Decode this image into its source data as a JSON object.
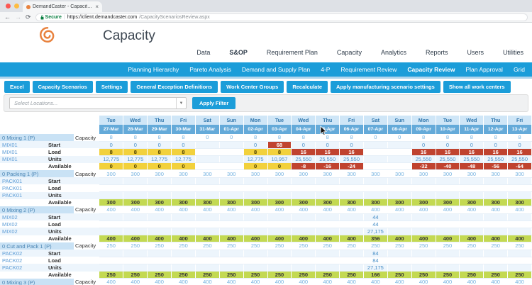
{
  "browser": {
    "tab_title": "DemandCaster - Capacity Rev",
    "close_glyph": "×",
    "back_glyph": "←",
    "forward_glyph": "→",
    "reload_glyph": "⟳",
    "secure_label": "Secure",
    "url_host": "https://client.demandcaster.com",
    "url_path": "/CapacityScenariosReview.aspx"
  },
  "header": {
    "app_title": "Capacity"
  },
  "top_nav": {
    "items": [
      "Data",
      "S&OP",
      "Requirement Plan",
      "Capacity",
      "Analytics",
      "Reports",
      "Users",
      "Utilities"
    ],
    "active": "S&OP"
  },
  "sub_nav": {
    "items": [
      "Planning Hierarchy",
      "Pareto Analysis",
      "Demand and Supply Plan",
      "4-P",
      "Requirement Review",
      "Capacity Review",
      "Plan Approval",
      "Grid"
    ],
    "active": "Capacity Review"
  },
  "toolbar": {
    "buttons": [
      "Excel",
      "Capacity Scenarios",
      "Settings",
      "General Exception Definitions",
      "Work Center Groups",
      "Recalculate",
      "Apply manufacturing scenario settings",
      "Show all work centers"
    ]
  },
  "filter": {
    "location_placeholder": "Select Locations...",
    "dropdown_arrow": "▼",
    "apply_label": "Apply Filter"
  },
  "colors": {
    "accent": "#1b9dd9",
    "day_header_bg": "#cfe6f7",
    "date_header_bg": "#64aad9",
    "group_header_bg": "#c9e2f5",
    "yellow": "#f2d13c",
    "red": "#c0432f",
    "green": "#c3d952"
  },
  "table": {
    "style_legend": "cell prefixes: y:=yellow, r:=red, g:=green, plain = no highlight, empty = blank cell",
    "columns": [
      {
        "day": "Tue",
        "date": "27-Mar"
      },
      {
        "day": "Wed",
        "date": "28-Mar"
      },
      {
        "day": "Thu",
        "date": "29-Mar"
      },
      {
        "day": "Fri",
        "date": "30-Mar"
      },
      {
        "day": "Sat",
        "date": "31-Mar"
      },
      {
        "day": "Sun",
        "date": "01-Apr"
      },
      {
        "day": "Mon",
        "date": "02-Apr"
      },
      {
        "day": "Tue",
        "date": "03-Apr"
      },
      {
        "day": "Wed",
        "date": "04-Apr"
      },
      {
        "day": "Thu",
        "date": "05-Apr"
      },
      {
        "day": "Fri",
        "date": "06-Apr"
      },
      {
        "day": "Sat",
        "date": "07-Apr"
      },
      {
        "day": "Sun",
        "date": "08-Apr"
      },
      {
        "day": "Mon",
        "date": "09-Apr"
      },
      {
        "day": "Tue",
        "date": "10-Apr"
      },
      {
        "day": "Wed",
        "date": "11-Apr"
      },
      {
        "day": "Thu",
        "date": "12-Apr"
      },
      {
        "day": "Fri",
        "date": "13-Apr"
      }
    ],
    "row_labels": {
      "capacity": "Capacity",
      "start": "Start",
      "load": "Load",
      "units": "Units",
      "available": "Available"
    },
    "groups": [
      {
        "name": "0 Mixing 1 (P)",
        "code": "MIX01",
        "rows": {
          "capacity": [
            "8",
            "8",
            "8",
            "8",
            "0",
            "0",
            "8",
            "8",
            "8",
            "8",
            "8",
            "0",
            "0",
            "8",
            "8",
            "8",
            "8",
            "8"
          ],
          "start": [
            "0",
            "0",
            "0",
            "0",
            "",
            "",
            "0",
            "r:68",
            "0",
            "0",
            "0",
            "",
            "",
            "0",
            "0",
            "0",
            "0",
            "0"
          ],
          "load": [
            "y:8",
            "y:8",
            "y:8",
            "y:8",
            "",
            "",
            "y:8",
            "y:8",
            "r:16",
            "r:16",
            "r:16",
            "",
            "",
            "r:16",
            "r:16",
            "r:16",
            "r:16",
            "r:16"
          ],
          "units": [
            "12,775",
            "12,775",
            "12,775",
            "12,775",
            "",
            "",
            "12,775",
            "10,957",
            "25,550",
            "25,550",
            "25,550",
            "",
            "",
            "25,550",
            "25,550",
            "25,550",
            "25,550",
            "25,550"
          ],
          "available": [
            "y:0",
            "y:0",
            "y:0",
            "y:0",
            "",
            "",
            "y:0",
            "y:0",
            "r:-8",
            "r:-16",
            "r:-24",
            "",
            "",
            "r:-32",
            "r:-40",
            "r:-48",
            "r:-56",
            "r:-64"
          ]
        }
      },
      {
        "name": "0 Packing 1 (P)",
        "code": "PACK01",
        "rows": {
          "capacity": [
            "300",
            "300",
            "300",
            "300",
            "300",
            "300",
            "300",
            "300",
            "300",
            "300",
            "300",
            "300",
            "300",
            "300",
            "300",
            "300",
            "300",
            "300"
          ],
          "start": [
            "",
            "",
            "",
            "",
            "",
            "",
            "",
            "",
            "",
            "",
            "",
            "",
            "",
            "",
            "",
            "",
            "",
            ""
          ],
          "load": [
            "",
            "",
            "",
            "",
            "",
            "",
            "",
            "",
            "",
            "",
            "",
            "",
            "",
            "",
            "",
            "",
            "",
            ""
          ],
          "units": [
            "",
            "",
            "",
            "",
            "",
            "",
            "",
            "",
            "",
            "",
            "",
            "",
            "",
            "",
            "",
            "",
            "",
            ""
          ],
          "available": [
            "g:300",
            "g:300",
            "g:300",
            "g:300",
            "g:300",
            "g:300",
            "g:300",
            "g:300",
            "g:300",
            "g:300",
            "g:300",
            "g:300",
            "g:300",
            "g:300",
            "g:300",
            "g:300",
            "g:300",
            "g:300"
          ]
        }
      },
      {
        "name": "0 Mixing 2 (P)",
        "code": "MIX02",
        "rows": {
          "capacity": [
            "400",
            "400",
            "400",
            "400",
            "400",
            "400",
            "400",
            "400",
            "400",
            "400",
            "400",
            "400",
            "400",
            "400",
            "400",
            "400",
            "400",
            "400"
          ],
          "start": [
            "",
            "",
            "",
            "",
            "",
            "",
            "",
            "",
            "",
            "",
            "",
            "44",
            "",
            "",
            "",
            "",
            "",
            ""
          ],
          "load": [
            "",
            "",
            "",
            "",
            "",
            "",
            "",
            "",
            "",
            "",
            "",
            "44",
            "",
            "",
            "",
            "",
            "",
            ""
          ],
          "units": [
            "",
            "",
            "",
            "",
            "",
            "",
            "",
            "",
            "",
            "",
            "",
            "27,175",
            "",
            "",
            "",
            "",
            "",
            ""
          ],
          "available": [
            "g:400",
            "g:400",
            "g:400",
            "g:400",
            "g:400",
            "g:400",
            "g:400",
            "g:400",
            "g:400",
            "g:400",
            "g:400",
            "g:356",
            "g:400",
            "g:400",
            "g:400",
            "g:400",
            "g:400",
            "g:400"
          ]
        }
      },
      {
        "name": "0 Cut and Pack 1 (P)",
        "code": "PACK02",
        "rows": {
          "capacity": [
            "250",
            "250",
            "250",
            "250",
            "250",
            "250",
            "250",
            "250",
            "250",
            "250",
            "250",
            "250",
            "250",
            "250",
            "250",
            "250",
            "250",
            "250"
          ],
          "start": [
            "",
            "",
            "",
            "",
            "",
            "",
            "",
            "",
            "",
            "",
            "",
            "84",
            "",
            "",
            "",
            "",
            "",
            ""
          ],
          "load": [
            "",
            "",
            "",
            "",
            "",
            "",
            "",
            "",
            "",
            "",
            "",
            "84",
            "",
            "",
            "",
            "",
            "",
            ""
          ],
          "units": [
            "",
            "",
            "",
            "",
            "",
            "",
            "",
            "",
            "",
            "",
            "",
            "27,175",
            "",
            "",
            "",
            "",
            "",
            ""
          ],
          "available": [
            "g:250",
            "g:250",
            "g:250",
            "g:250",
            "g:250",
            "g:250",
            "g:250",
            "g:250",
            "g:250",
            "g:250",
            "g:250",
            "g:166",
            "g:250",
            "g:250",
            "g:250",
            "g:250",
            "g:250",
            "g:250"
          ]
        }
      },
      {
        "name": "0 Mixing 3 (P)",
        "code": "MIX03",
        "rows": {
          "capacity": [
            "400",
            "400",
            "400",
            "400",
            "400",
            "400",
            "400",
            "400",
            "400",
            "400",
            "400",
            "400",
            "400",
            "400",
            "400",
            "400",
            "400",
            "400"
          ]
        }
      }
    ]
  }
}
